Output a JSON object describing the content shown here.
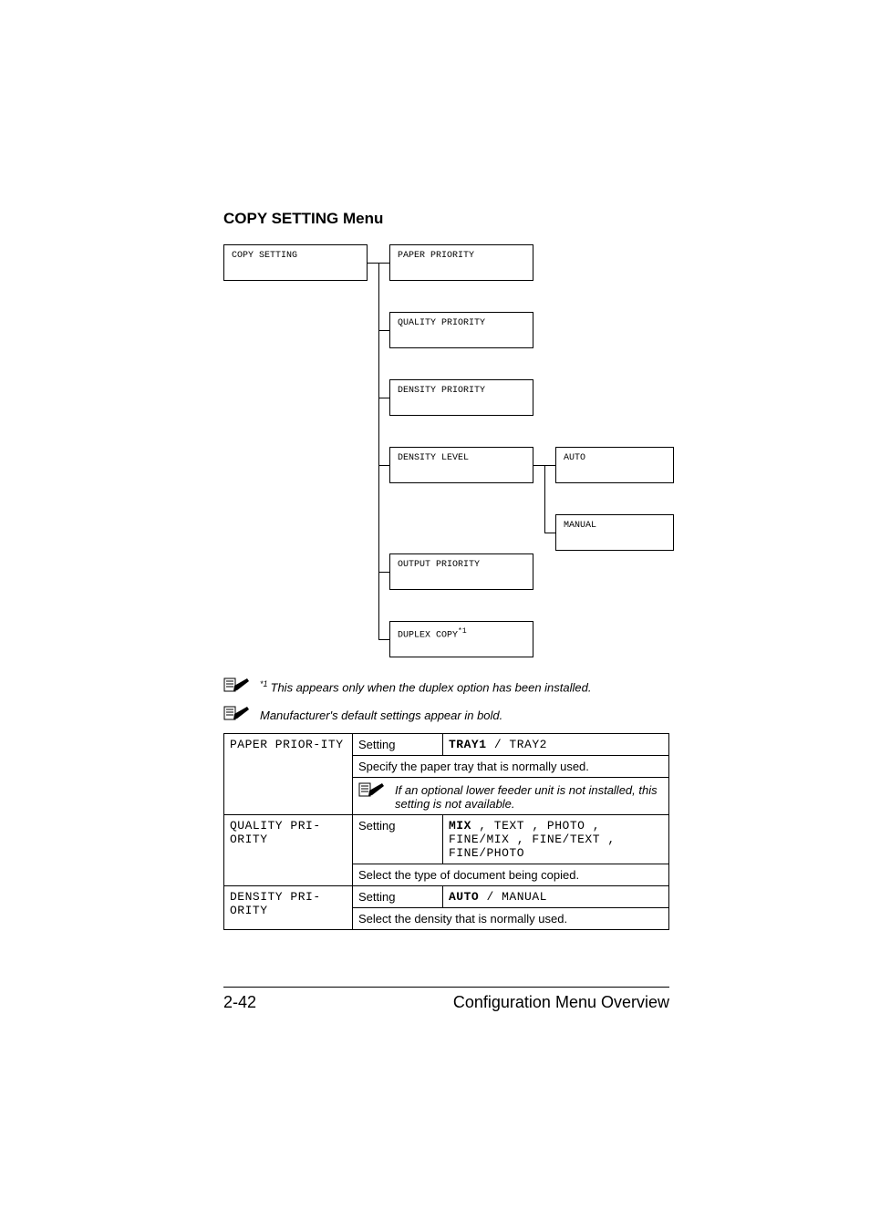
{
  "heading": "COPY SETTING Menu",
  "flow": {
    "root": "COPY SETTING",
    "col2": [
      "PAPER PRIORITY",
      "QUALITY PRIORITY",
      "DENSITY PRIORITY",
      "DENSITY LEVEL",
      "OUTPUT PRIORITY",
      "DUPLEX COPY"
    ],
    "duplex_sup": "*1",
    "col3": [
      "AUTO",
      "MANUAL"
    ]
  },
  "notes": {
    "n1_sup": "*1",
    "n1": "This appears only when the duplex option has been installed.",
    "n2": "Manufacturer's default settings appear in bold."
  },
  "table": {
    "rows": [
      {
        "name": "PAPER PRIOR-ITY",
        "setting_label": "Setting",
        "options_bold": "TRAY1",
        "options_rest": " / TRAY2",
        "desc": "Specify the paper tray that is normally used.",
        "note": "If an optional lower feeder unit is not installed, this setting is not available."
      },
      {
        "name": "QUALITY PRI-ORITY",
        "setting_label": "Setting",
        "options_bold": "MIX",
        "options_rest": " , TEXT , PHOTO , FINE/MIX , FINE/TEXT , FINE/PHOTO",
        "desc": "Select the type of document being copied."
      },
      {
        "name": "DENSITY PRI-ORITY",
        "setting_label": "Setting",
        "options_bold": "AUTO",
        "options_rest": " / MANUAL",
        "desc": "Select the density that is normally used."
      }
    ]
  },
  "footer": {
    "page": "2-42",
    "title": "Configuration Menu Overview"
  }
}
